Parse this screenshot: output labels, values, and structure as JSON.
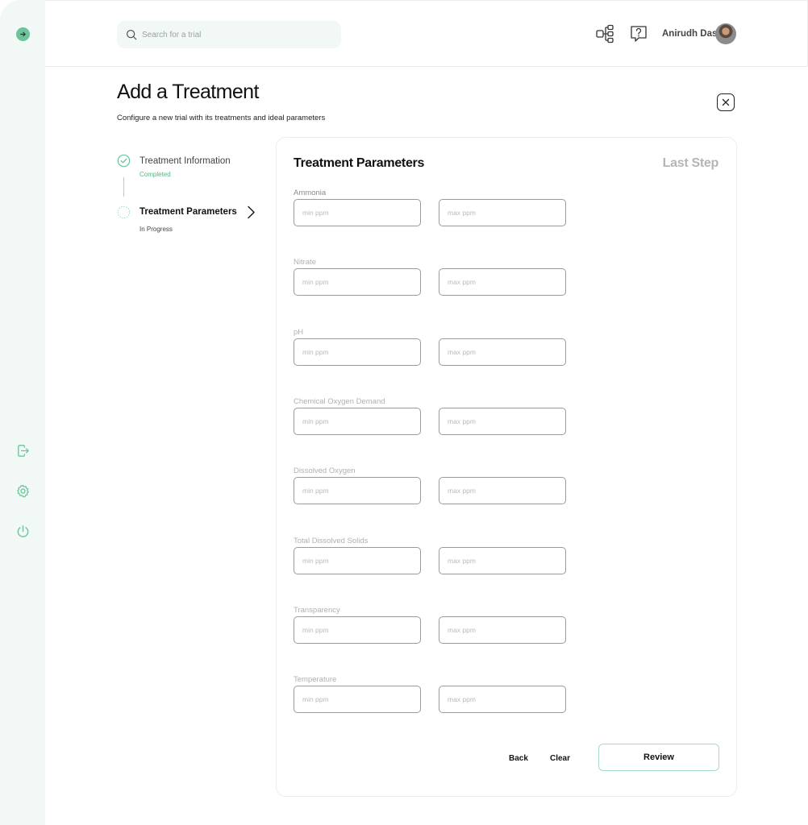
{
  "header": {
    "search_placeholder": "Search for a trial",
    "user_name": "Anirudh Das"
  },
  "page": {
    "title": "Add a Treatment",
    "subtitle": "Configure a new trial with its treatments and ideal parameters"
  },
  "stepper": [
    {
      "title": "Treatment Information",
      "status": "Completed"
    },
    {
      "title": "Treatment Parameters",
      "status": "In Progress"
    }
  ],
  "card": {
    "title": "Treatment Parameters",
    "step_label": "Last Step",
    "min_placeholder": "min ppm",
    "max_placeholder": "max ppm",
    "parameters": [
      "Ammonia",
      "Nitrate",
      "pH",
      "Chemical Oxygen Demand",
      "Dissolved Oxygen",
      "Total Dissolved Solids",
      "Transparency",
      "Temperature"
    ],
    "back_label": "Back",
    "clear_label": "Clear",
    "review_label": "Review"
  },
  "colors": {
    "accent": "#6dc49a",
    "sidebar_bg": "#f2f8f5",
    "review_border": "#a6dcc2"
  }
}
